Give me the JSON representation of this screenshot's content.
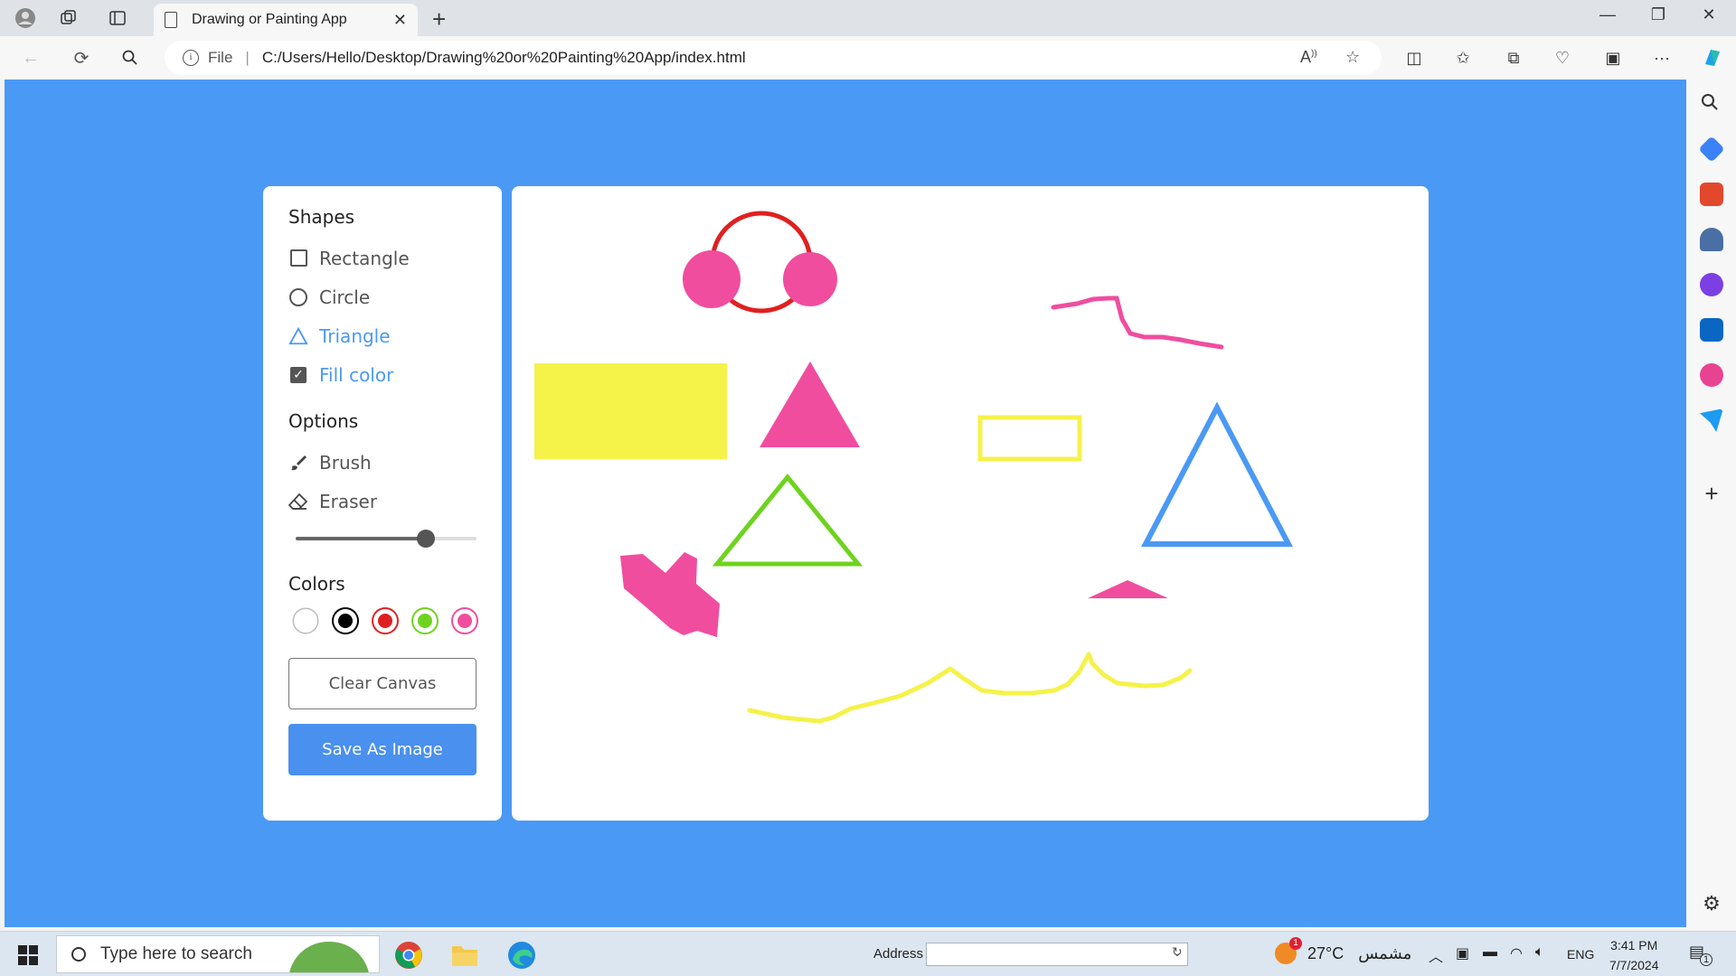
{
  "browser": {
    "tab_title": "Drawing or Painting App",
    "url_scheme": "File",
    "url": "C:/Users/Hello/Desktop/Drawing%20or%20Painting%20App/index.html"
  },
  "panel": {
    "shapes_title": "Shapes",
    "shapes": [
      {
        "label": "Rectangle",
        "icon": "square-icon",
        "active": false
      },
      {
        "label": "Circle",
        "icon": "circle-icon",
        "active": false
      },
      {
        "label": "Triangle",
        "icon": "triangle-icon",
        "active": true
      }
    ],
    "fill_color": {
      "label": "Fill color",
      "checked": true
    },
    "options_title": "Options",
    "options": [
      {
        "label": "Brush",
        "icon": "brush-icon"
      },
      {
        "label": "Eraser",
        "icon": "eraser-icon"
      }
    ],
    "brush_size_fraction": 0.72,
    "colors_title": "Colors",
    "colors": [
      {
        "name": "white",
        "hex": "#ffffff",
        "selected": false
      },
      {
        "name": "black",
        "hex": "#000000",
        "selected": true
      },
      {
        "name": "red",
        "hex": "#e02020",
        "selected": true
      },
      {
        "name": "green",
        "hex": "#6ed31e",
        "selected": true
      },
      {
        "name": "pink",
        "hex": "#f04d9f",
        "selected": true
      }
    ],
    "clear_label": "Clear Canvas",
    "save_label": "Save As Image"
  },
  "palette": {
    "accent": "#4a99f5",
    "background": "#4a99f5"
  },
  "taskbar": {
    "search_placeholder": "Type here to search",
    "address_label": "Address",
    "temperature": "27°C",
    "weather_text": "مشمس",
    "weather_badge": "1",
    "language": "ENG",
    "time": "3:41 PM",
    "date": "7/7/2024",
    "notification_count": "1"
  }
}
